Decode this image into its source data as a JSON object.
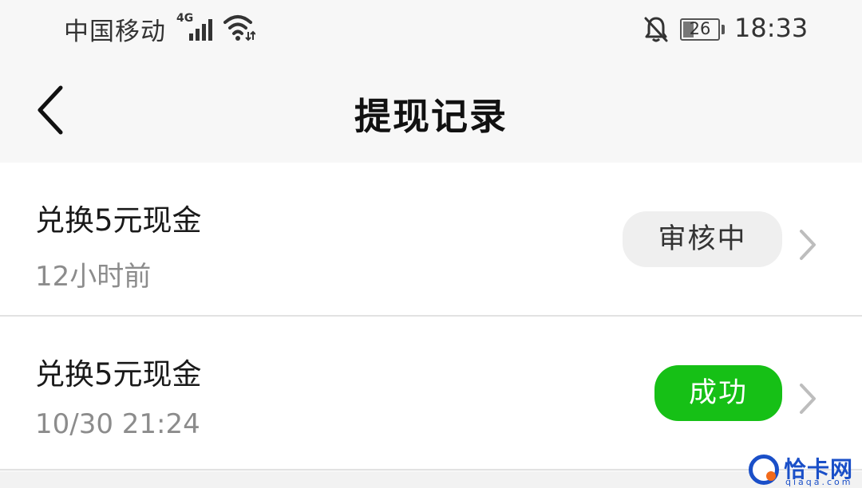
{
  "status_bar": {
    "carrier": "中国移动",
    "network_type": "4G",
    "battery_level": "26",
    "time": "18:33",
    "icons": [
      "signal-icon",
      "wifi-icon",
      "notifications-muted-icon",
      "battery-icon"
    ]
  },
  "nav": {
    "title": "提现记录",
    "back_icon": "chevron-left-icon"
  },
  "records": [
    {
      "title": "兑换5元现金",
      "time": "12小时前",
      "status": "审核中",
      "status_type": "pending",
      "status_color": "#efefef"
    },
    {
      "title": "兑换5元现金",
      "time": "10/30 21:24",
      "status": "成功",
      "status_type": "success",
      "status_color": "#16c016"
    }
  ],
  "watermark": {
    "text": "恰卡网",
    "sub": "qiaqa.com"
  }
}
